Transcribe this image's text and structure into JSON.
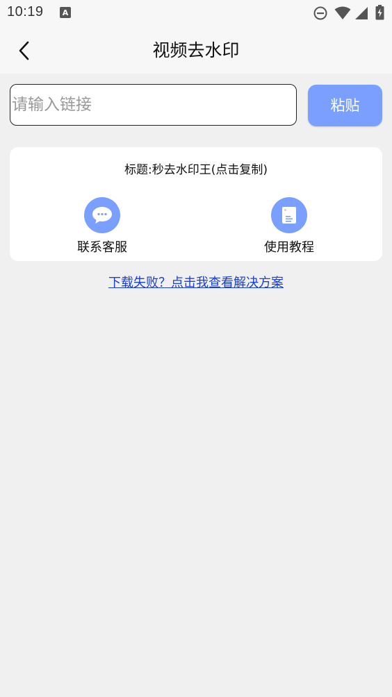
{
  "status_bar": {
    "time": "10:19"
  },
  "header": {
    "title": "视频去水印"
  },
  "input": {
    "placeholder": "请输入链接",
    "value": ""
  },
  "paste_label": "粘贴",
  "card": {
    "title": "标题:秒去水印王(点击复制)",
    "actions": [
      {
        "label": "联系客服",
        "icon": "chat-bubble-icon"
      },
      {
        "label": "使用教程",
        "icon": "document-icon"
      }
    ]
  },
  "help_link": "下载失败？点击我查看解决方案",
  "colors": {
    "accent": "#7a9fff",
    "link": "#1a3fd6",
    "background": "#f0f0f0"
  }
}
